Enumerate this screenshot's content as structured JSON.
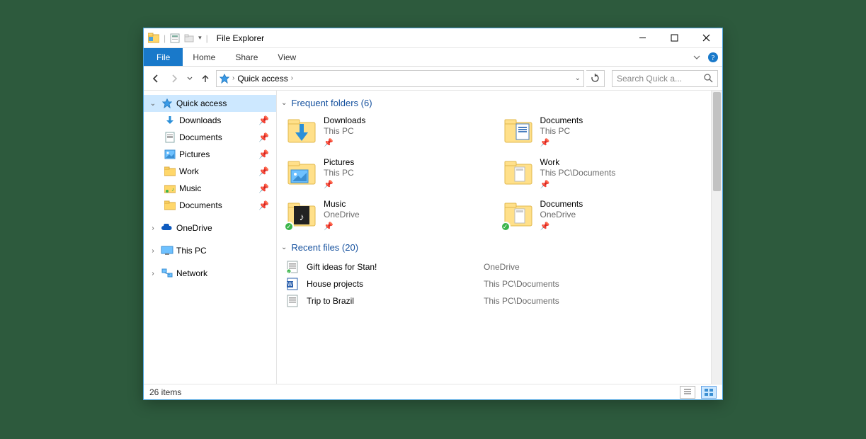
{
  "window": {
    "title": "File Explorer"
  },
  "ribbon": {
    "file": "File",
    "tabs": [
      "Home",
      "Share",
      "View"
    ]
  },
  "nav": {
    "breadcrumb": "Quick access",
    "search_placeholder": "Search Quick a..."
  },
  "sidebar": {
    "quick_access": "Quick access",
    "items": [
      {
        "label": "Downloads",
        "icon": "download"
      },
      {
        "label": "Documents",
        "icon": "doc"
      },
      {
        "label": "Pictures",
        "icon": "pic"
      },
      {
        "label": "Work",
        "icon": "folder"
      },
      {
        "label": "Music",
        "icon": "music"
      },
      {
        "label": "Documents",
        "icon": "doc"
      }
    ],
    "onedrive": "OneDrive",
    "thispc": "This PC",
    "network": "Network"
  },
  "groups": {
    "frequent": {
      "header": "Frequent folders (6)",
      "items": [
        {
          "name": "Downloads",
          "location": "This PC",
          "overlay": "download",
          "sync": false
        },
        {
          "name": "Documents",
          "location": "This PC",
          "overlay": "doc",
          "sync": false
        },
        {
          "name": "Pictures",
          "location": "This PC",
          "overlay": "pic",
          "sync": false
        },
        {
          "name": "Work",
          "location": "This PC\\Documents",
          "overlay": "file",
          "sync": false
        },
        {
          "name": "Music",
          "location": "OneDrive",
          "overlay": "music",
          "sync": true
        },
        {
          "name": "Documents",
          "location": "OneDrive",
          "overlay": "file",
          "sync": true
        }
      ]
    },
    "recent": {
      "header": "Recent files (20)",
      "items": [
        {
          "name": "Gift ideas for Stan!",
          "location": "OneDrive",
          "icon": "text",
          "sync": true
        },
        {
          "name": "House projects",
          "location": "This PC\\Documents",
          "icon": "word",
          "sync": false
        },
        {
          "name": "Trip to Brazil",
          "location": "This PC\\Documents",
          "icon": "text",
          "sync": false
        }
      ]
    }
  },
  "statusbar": {
    "count": "26 items"
  }
}
